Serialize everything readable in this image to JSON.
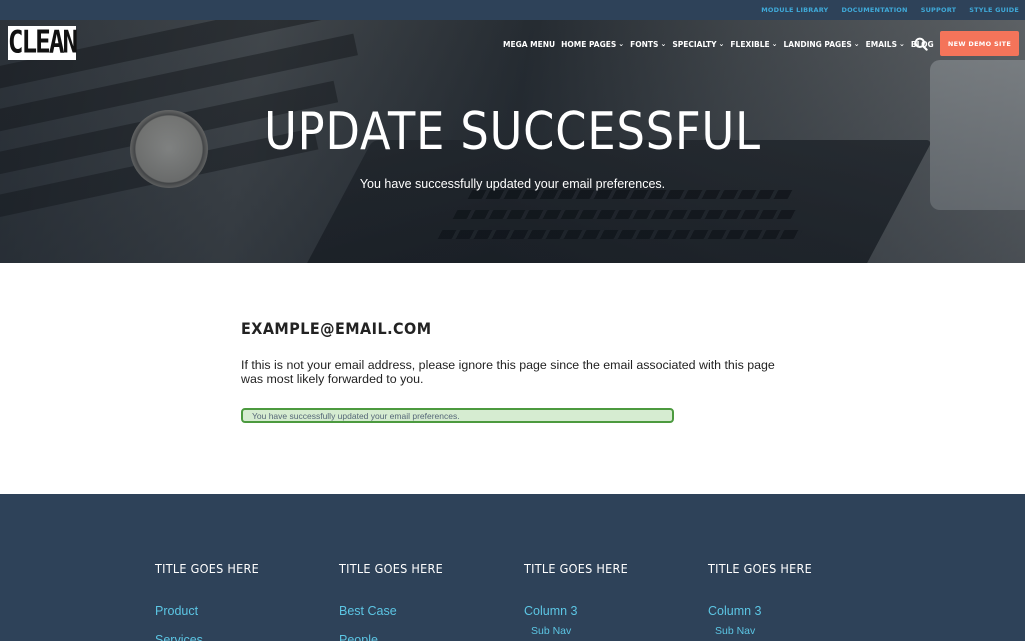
{
  "utility_nav": [
    "MODULE LIBRARY",
    "DOCUMENTATION",
    "SUPPORT",
    "STYLE GUIDE"
  ],
  "logo_text": "CLEAN",
  "main_nav": [
    {
      "label": "MEGA MENU",
      "has_dropdown": false
    },
    {
      "label": "HOME PAGES",
      "has_dropdown": true
    },
    {
      "label": "FONTS",
      "has_dropdown": true
    },
    {
      "label": "SPECIALTY",
      "has_dropdown": true
    },
    {
      "label": "FLEXIBLE",
      "has_dropdown": true
    },
    {
      "label": "LANDING PAGES",
      "has_dropdown": true
    },
    {
      "label": "EMAILS",
      "has_dropdown": true
    },
    {
      "label": "BLOG",
      "has_dropdown": false
    }
  ],
  "demo_button": "NEW DEMO SITE",
  "hero": {
    "title": "UPDATE SUCCESSFUL",
    "subtitle": "You have successfully updated your email preferences."
  },
  "content": {
    "email": "EXAMPLE@EMAIL.COM",
    "notice": "If this is not your email address, please ignore this page since the email associated with this page was most likely forwarded to you.",
    "success_message": "You have successfully updated your email preferences."
  },
  "footer": {
    "columns": [
      {
        "title": "TITLE GOES HERE",
        "link": "Product",
        "sub": "",
        "link2": "Services"
      },
      {
        "title": "TITLE GOES HERE",
        "link": "Best Case",
        "sub": "",
        "link2": "People"
      },
      {
        "title": "TITLE GOES HERE",
        "link": "Column 3",
        "sub": "Sub Nav",
        "link2": ""
      },
      {
        "title": "TITLE GOES HERE",
        "link": "Column 3",
        "sub": "Sub Nav",
        "link2": ""
      }
    ]
  },
  "colors": {
    "header_bg": "#2e4259",
    "accent_link": "#3fa9d8",
    "button_coral": "#f4745a",
    "success_border": "#4c9a3f",
    "success_bg": "#d6ecd1"
  }
}
